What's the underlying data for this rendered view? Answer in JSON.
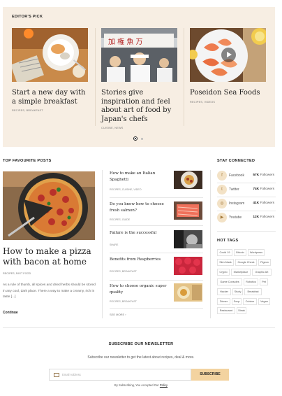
{
  "editors_pick": {
    "title": "EDITOR'S PICK",
    "items": [
      {
        "title": "Start a new day with a simple breakfast",
        "meta": "RECIPES, BREAKFAST"
      },
      {
        "title": "Stories give inspiration and feel about art of food by Japan's chefs",
        "meta": "CUISINE, NEWS"
      },
      {
        "title": "Poseidon Sea Foods",
        "meta": "RECIPES, VIDEOS"
      }
    ]
  },
  "top_posts": {
    "title": "TOP FAVOURITE POSTS",
    "featured": {
      "title": "How to make a pizza with bacon at home",
      "meta": "RECIPES, FAST FOOD",
      "excerpt": "As a rule of thumb, all spices and dried herbs should be stored in any cool, dark place. There a way to make a creamy, rich in taste [...]",
      "continue": "Continue"
    },
    "list": [
      {
        "title": "How to make an Italian Spaghetti",
        "meta": "RECIPES, CUISINE, VIDEO"
      },
      {
        "title": "Do you know how to choose fresh salmon?",
        "meta": "RECIPES, GUIDE"
      },
      {
        "title": "Failure is the successful",
        "meta": "SHARE"
      },
      {
        "title": "Benefits from Raspberries",
        "meta": "RECIPES, BREAKFAST"
      },
      {
        "title": "How to choose organic super quality",
        "meta": "RECIPES, BREAKFAST"
      }
    ],
    "see_more": "SEE MORE"
  },
  "stay_connected": {
    "title": "STAY CONNECTED",
    "networks": [
      {
        "name": "Facebook",
        "count": "57K",
        "unit": "Followers",
        "icon": "facebook-icon"
      },
      {
        "name": "Twitter",
        "count": "74K",
        "unit": "Followers",
        "icon": "twitter-icon"
      },
      {
        "name": "Instagram",
        "count": "41K",
        "unit": "Followers",
        "icon": "instagram-icon"
      },
      {
        "name": "Youtube",
        "count": "12K",
        "unit": "Followers",
        "icon": "youtube-icon"
      }
    ]
  },
  "hot_tags": {
    "title": "HOT TAGS",
    "tags": [
      "Covid 19",
      "Bitcoin",
      "Wordpress",
      "Skin Mask",
      "Google Check",
      "Pigeon",
      "Crypto",
      "Marketplace",
      "Graphic Art",
      "Game Consoles",
      "Robotics",
      "Pet",
      "Hacker",
      "Study",
      "Breakfast",
      "Dinner",
      "Soup",
      "Cuisine",
      "Vegan",
      "Restaurant",
      "Steak"
    ]
  },
  "newsletter": {
    "title": "SUBSCRIBE OUR NEWSLETTER",
    "subtitle": "Subscribe our newsletter to get the latest about recipes, deal & more.",
    "placeholder": "Email Address",
    "button": "SUBSCRIBE",
    "note_prefix": "By Subscribing, You Accepted Our",
    "note_link": "Policy"
  },
  "colors": {
    "accent": "#f3d3a0",
    "pick_bg": "#f7eee3"
  }
}
